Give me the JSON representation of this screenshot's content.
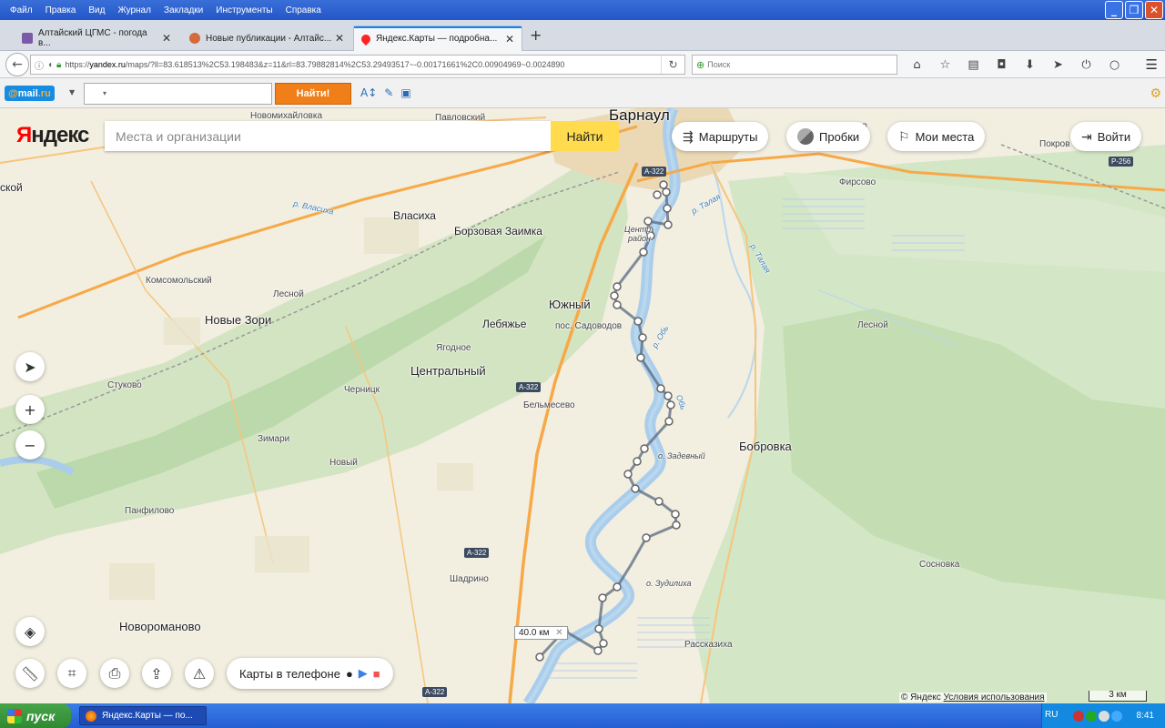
{
  "menubar": {
    "items": [
      "Файл",
      "Правка",
      "Вид",
      "Журнал",
      "Закладки",
      "Инструменты",
      "Справка"
    ]
  },
  "tabs": [
    {
      "title": "Алтайский ЦГМС - погода в...",
      "close": "✕"
    },
    {
      "title": "Новые публикации - Алтайс...",
      "close": "✕"
    },
    {
      "title": "Яндекс.Карты — подробна...",
      "close": "✕"
    }
  ],
  "newtab": "+",
  "urlbar": {
    "prefix": "https://",
    "host": "yandex.ru",
    "path": "/maps/?ll=83.618513%2C53.198483&z=11&rl=83.79882814%2C53.29493517~-0.00171661%2C0.00904969~0.0024890"
  },
  "searchbar": {
    "placeholder": "Поиск"
  },
  "mailbar": {
    "logo_at": "@",
    "logo_text": "mail",
    "logo_tld": ".ru",
    "search_value": "▾",
    "button": "Найти!"
  },
  "map": {
    "logo_ya": "Я",
    "logo_rest": "ндекс",
    "search_placeholder": "Места и организации",
    "find_button": "Найти",
    "routes": "Маршруты",
    "traffic": "Пробки",
    "myplaces": "Мои места",
    "login": "Войти",
    "mobile": "Карты в телефоне",
    "distance": "40.0 км",
    "distance_close": "✕",
    "copyright": "© Яндекс",
    "terms": "Условия использования",
    "scale": "3 км",
    "labels": {
      "barnaul": "Барнаул",
      "novomikhailovka": "Новомихайловка",
      "pavlovsky": "Павловский",
      "skoy": "ской",
      "vlasikha": "Власиха",
      "borzovaya": "Борзовая Заимка",
      "komsomolsky": "Комсомольский",
      "lesnoy1": "Лесной",
      "novye_zori": "Новые Зори",
      "yuzhny": "Южный",
      "lebyazhye": "Лебяжье",
      "sadovodov": "пос. Садоводов",
      "yagodnoe": "Ягодное",
      "tsentralny": "Центральный",
      "stukovo": "Стуково",
      "chernitsk": "Черницк",
      "belmesevo": "Бельмесево",
      "zimari": "Зимари",
      "novy": "Новый",
      "panfilovo": "Панфилово",
      "shadrino": "Шадрино",
      "novoromanovo": "Новороманово",
      "zadevny": "о. Задевный",
      "zudilikha": "о. Зудилиха",
      "bobrovka": "Бобровка",
      "sosnovka": "Сосновка",
      "rasskazikha": "Рассказиха",
      "lesnoy2": "Лесной",
      "firsovo": "Фирсово",
      "pokrov": "Покров",
      "tsentr": "Центр",
      "rayon": "район",
      "chikovo": "иков",
      "r_vlasikha": "р. Власиха",
      "r_talaya1": "р. Талая",
      "r_talaya2": "р. Талая",
      "r_ob": "р. Обь",
      "ob2": "Обь"
    },
    "shields": {
      "a322_top": "А-322",
      "r256": "Р-256",
      "a322_mid": "А-322",
      "a322_low": "А-322",
      "a322_bottom": "А-322"
    }
  },
  "taskbar": {
    "start": "пуск",
    "item": "Яндекс.Карты — по...",
    "lang": "RU",
    "clock": "8:41"
  }
}
